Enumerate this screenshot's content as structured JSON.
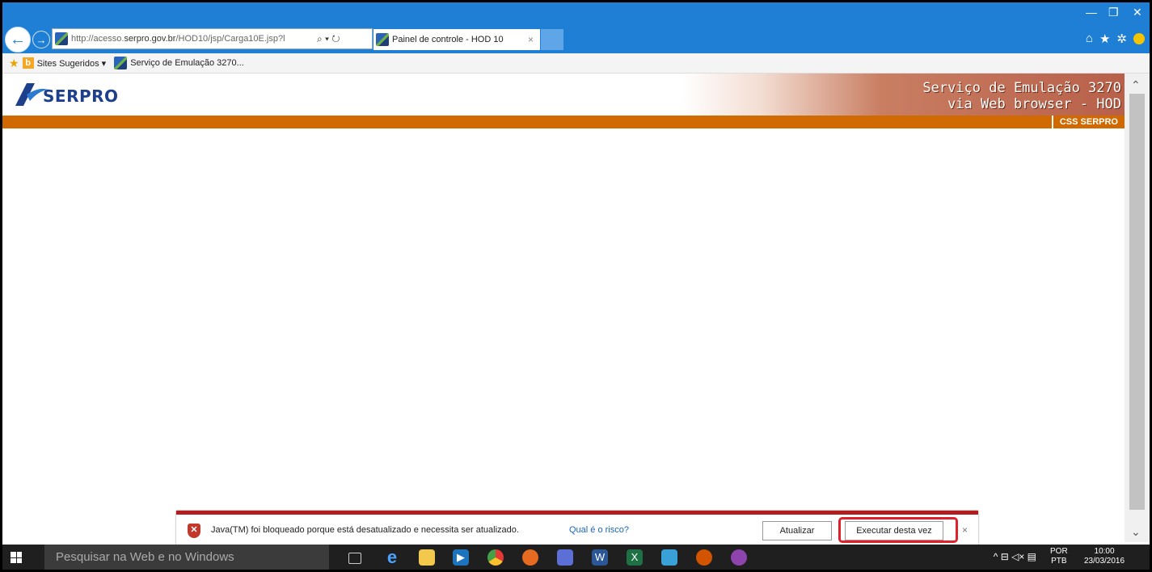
{
  "browser": {
    "url_host": "http://acesso.",
    "url_domain": "serpro.gov.br",
    "url_path": "/HOD10/jsp/Carga10E.jsp?l",
    "address_icons": "⌕ ▾ ↻",
    "tab_title": "Painel de controle - HOD 10",
    "tab_close": "×",
    "win_minimize": "—",
    "win_restore": "❐",
    "win_close": "✕"
  },
  "favorites": {
    "suggested": "Sites Sugeridos ▾",
    "emulation": "Serviço de Emulação 3270..."
  },
  "page": {
    "logo_text": "SERPRO",
    "header_line1": "Serviço de Emulação 3270",
    "header_line2": "via Web browser - HOD",
    "bar_label": "CSS SERPRO"
  },
  "notification": {
    "message": "Java(TM) foi bloqueado porque está desatualizado e necessita ser atualizado.",
    "link": "Qual é o risco?",
    "update_button": "Atualizar",
    "run_button": "Executar desta vez",
    "close": "×"
  },
  "taskbar": {
    "search_placeholder": "Pesquisar na Web e no Windows",
    "lang_1": "POR",
    "lang_2": "PTB",
    "time": "10:00",
    "date": "23/03/2016",
    "tray_icons": "^ ⊟ ◁× ▤"
  },
  "colors": {
    "titlebar": "#1f7fd5",
    "orange_bar": "#d06a00",
    "notif_border": "#b21d1d",
    "highlight": "#e0212a"
  }
}
